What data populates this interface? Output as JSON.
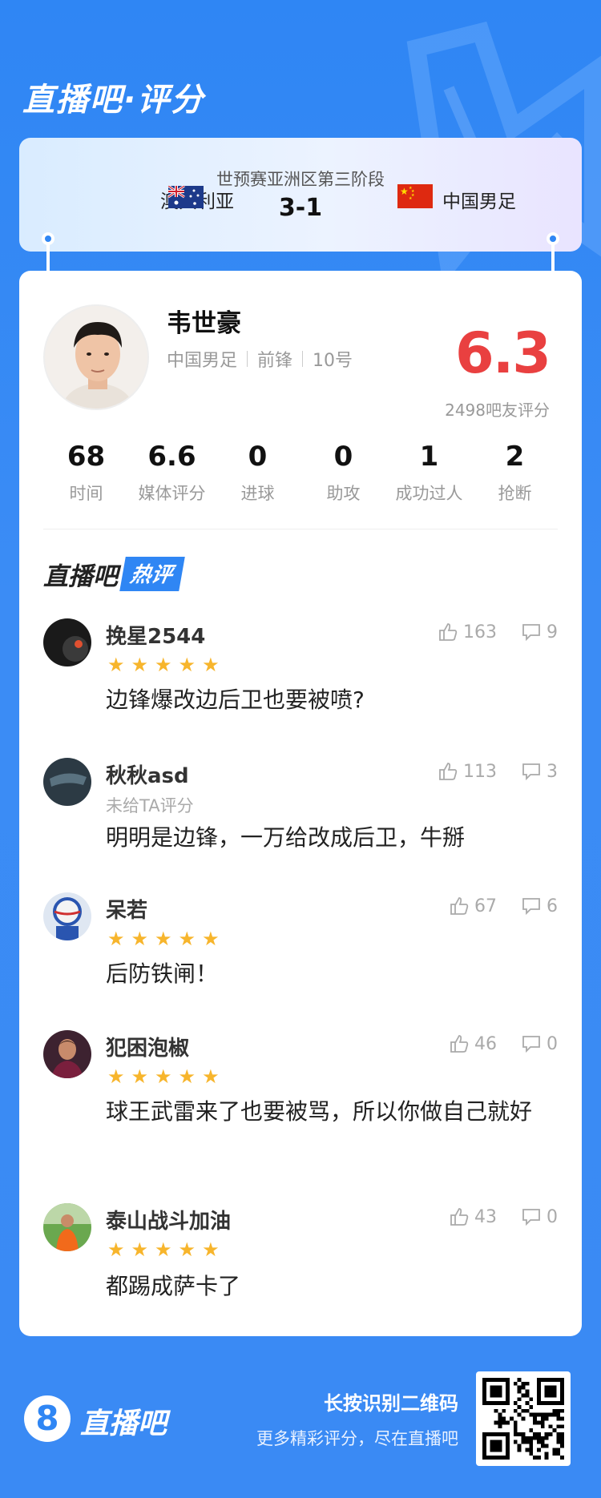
{
  "app": {
    "title": "直播吧·评分"
  },
  "match": {
    "stage": "世预赛亚洲区第三阶段",
    "score": "3-1",
    "home_team": "澳大利亚",
    "away_team": "中国男足"
  },
  "player": {
    "name": "韦世豪",
    "team": "中国男足",
    "position": "前锋",
    "number": "10号",
    "rating": "6.3",
    "rating_count": "2498吧友评分"
  },
  "stats": [
    {
      "value": "68",
      "label": "时间"
    },
    {
      "value": "6.6",
      "label": "媒体评分"
    },
    {
      "value": "0",
      "label": "进球"
    },
    {
      "value": "0",
      "label": "助攻"
    },
    {
      "value": "1",
      "label": "成功过人"
    },
    {
      "value": "2",
      "label": "抢断"
    }
  ],
  "hot_comments": {
    "title_a": "直播吧",
    "title_b": "热评",
    "items": [
      {
        "user": "挽星2544",
        "rated": true,
        "stars": 5,
        "text": "边锋爆改边后卫也要被喷?",
        "likes": "163",
        "dislikes": "9"
      },
      {
        "user": "秋秋asd",
        "rated": false,
        "sub": "未给TA评分",
        "text": "明明是边锋，一万给改成后卫，牛掰",
        "likes": "113",
        "dislikes": "3"
      },
      {
        "user": "呆若",
        "rated": true,
        "stars": 5,
        "text": "后防铁闸！",
        "likes": "67",
        "dislikes": "6"
      },
      {
        "user": "犯困泡椒",
        "rated": true,
        "stars": 5,
        "text": "球王武雷来了也要被骂，所以你做自己就好",
        "likes": "46",
        "dislikes": "0"
      },
      {
        "user": "泰山战斗加油",
        "rated": true,
        "stars": 5,
        "text": "都踢成萨卡了",
        "likes": "43",
        "dislikes": "0"
      }
    ]
  },
  "footer": {
    "logo_glyph": "8",
    "brand": "直播吧",
    "hint_title": "长按识别二维码",
    "hint_sub": "更多精彩评分，尽在直播吧"
  },
  "colors": {
    "brand_blue": "#2f86f4",
    "rating_red": "#e94040",
    "star_yellow": "#f7b52c"
  }
}
